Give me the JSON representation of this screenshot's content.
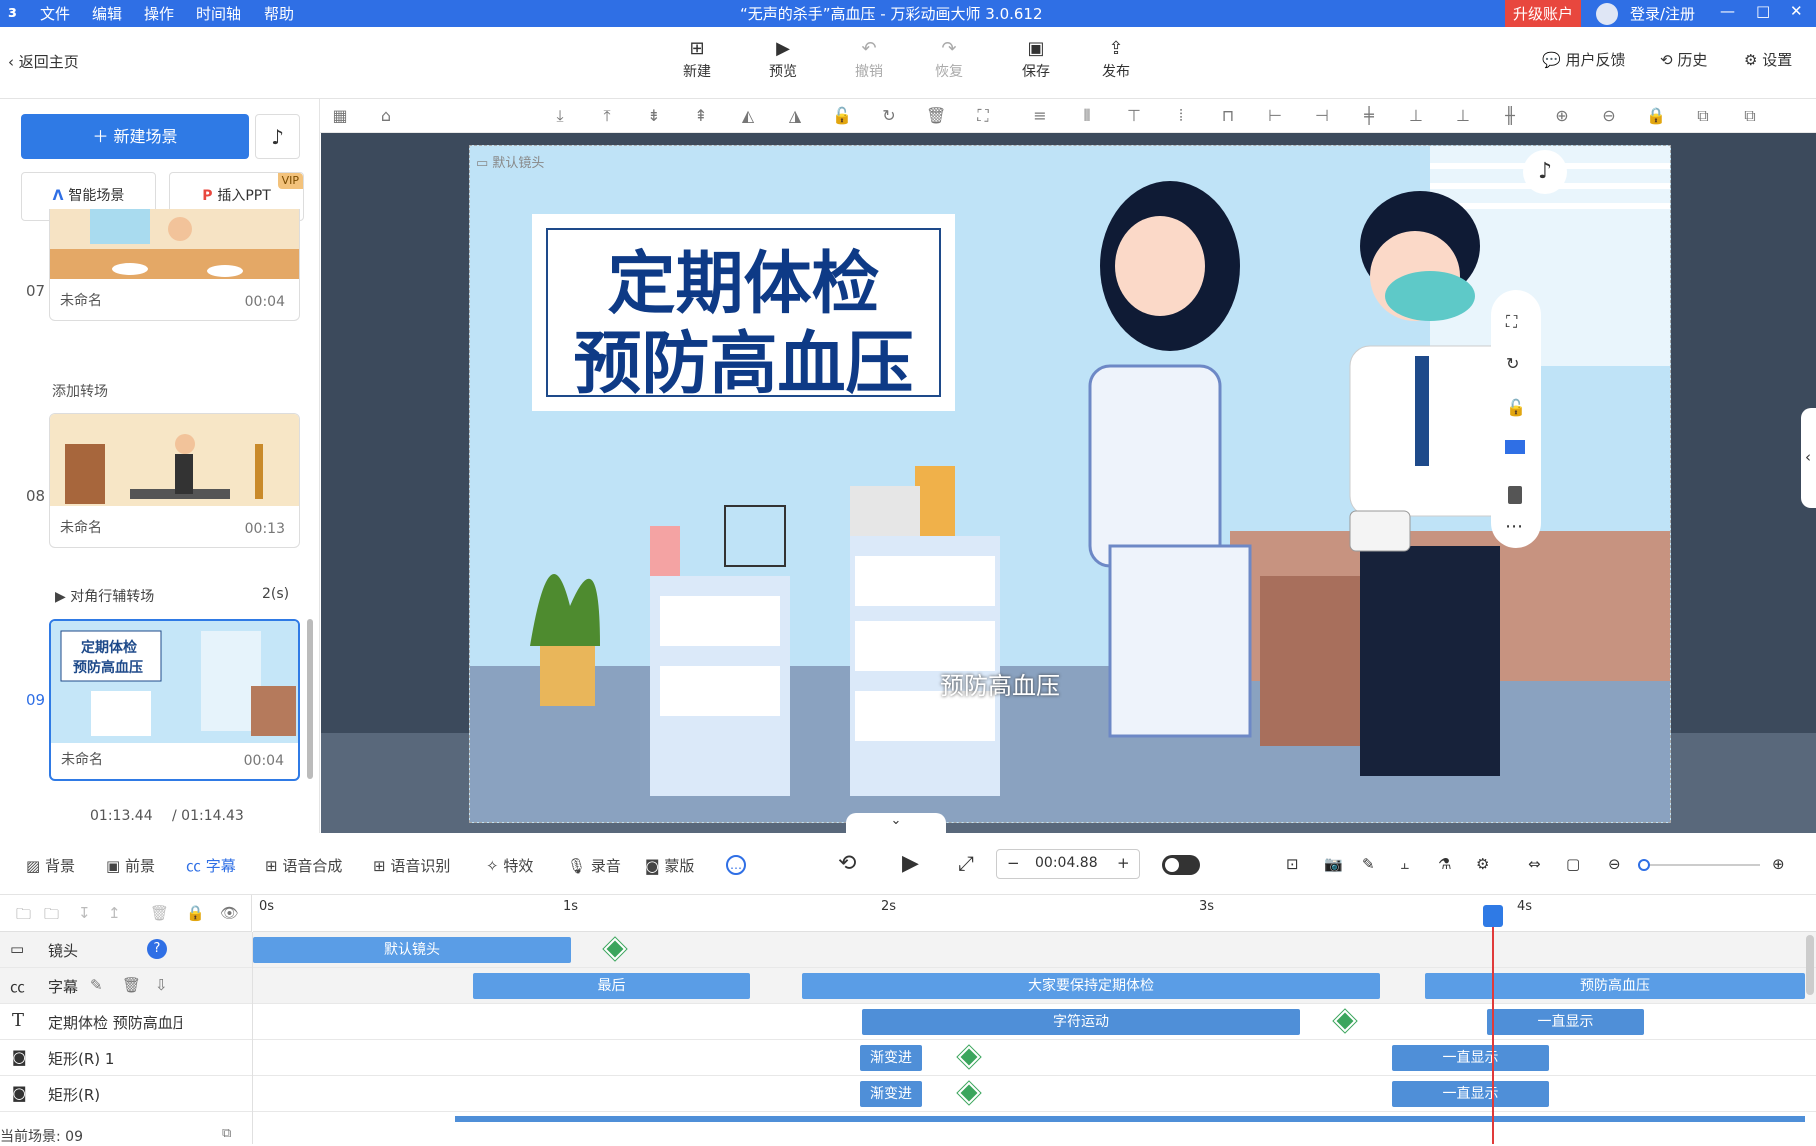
{
  "window": {
    "title": "“无声的杀手”高血压 - 万彩动画大师 3.0.612",
    "upgrade": "升级账户",
    "login": "登录/注册",
    "menu": [
      "文件",
      "编辑",
      "操作",
      "时间轴",
      "帮助"
    ]
  },
  "toolbar": {
    "back": "返回主页",
    "new": "新建",
    "preview": "预览",
    "undo": "撤销",
    "redo": "恢复",
    "save": "保存",
    "publish": "发布",
    "feedback": "用户反馈",
    "history": "历史",
    "settings": "设置"
  },
  "left": {
    "new_scene": "新建场景",
    "smart_scene": "智能场景",
    "insert_ppt": "插入PPT",
    "vip": "VIP",
    "scenes": [
      {
        "num": "07",
        "name": "未命名",
        "duration": "00:04"
      },
      {
        "num": "08",
        "name": "未命名",
        "duration": "00:13"
      },
      {
        "num": "09",
        "name": "未命名",
        "duration": "00:04"
      }
    ],
    "add_transition": "添加转场",
    "transition": "对角行辅转场",
    "transition_dur": "2(s)",
    "time_current": "01:13.44",
    "time_total": "/ 01:14.43",
    "thumb9_line1": "定期体检",
    "thumb9_line2": "预防高血压"
  },
  "stage": {
    "camera_label": "默认镜头",
    "headline1": "定期体检",
    "headline2": "预防高血压",
    "subtitle": "预防高血压"
  },
  "panels": {
    "tabs": [
      "背景",
      "前景",
      "字幕",
      "语音合成",
      "语音识别",
      "特效",
      "录音",
      "蒙版"
    ],
    "time": "00:04.88",
    "minus": "−",
    "plus": "+"
  },
  "timeline": {
    "ruler": [
      "0s",
      "1s",
      "2s",
      "3s",
      "4s"
    ],
    "tracks": [
      {
        "label": "镜头"
      },
      {
        "label": "字幕"
      },
      {
        "label": "定期体检 预防高血压"
      },
      {
        "label": "矩形(R) 1"
      },
      {
        "label": "矩形(R)"
      }
    ],
    "clips": {
      "camera": "默认镜头",
      "sub1": "最后",
      "sub2": "大家要保持定期体检",
      "sub3": "预防高血压",
      "text1": "字符运动",
      "text2": "一直显示",
      "r1a": "渐变进",
      "r1b": "一直显示",
      "r2a": "渐变进",
      "r2b": "一直显示"
    },
    "status": "当前场景: 09"
  },
  "colors": {
    "brand": "#2f6fe5",
    "clip": "#5a9de6",
    "upgrade": "#e8473e"
  }
}
